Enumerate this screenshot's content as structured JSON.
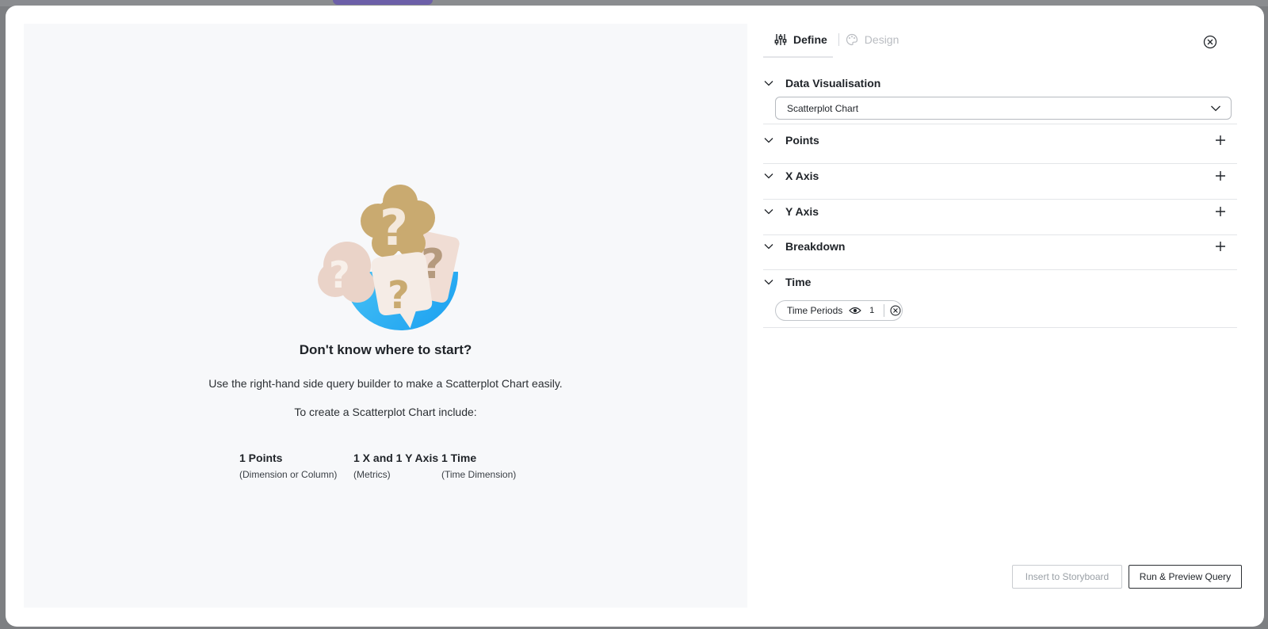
{
  "tabs": [
    {
      "label": "Define",
      "active": true,
      "icon": "sliders-icon"
    },
    {
      "label": "Design",
      "active": false,
      "icon": "palette-icon"
    }
  ],
  "empty_state": {
    "title": "Don't know where to start?",
    "description": "Use the right-hand side query builder to make a Scatterplot Chart easily.",
    "include_text": "To create a Scatterplot Chart include:",
    "requirements": [
      {
        "title": "1 Points",
        "subtitle": "(Dimension or Column)"
      },
      {
        "title": "1 X and 1 Y Axis",
        "subtitle": "(Metrics)"
      },
      {
        "title": "1 Time",
        "subtitle": "(Time Dimension)"
      }
    ]
  },
  "sections": {
    "data_visualisation": {
      "title": "Data Visualisation",
      "selected": "Scatterplot Chart"
    },
    "points": {
      "title": "Points"
    },
    "x_axis": {
      "title": "X Axis"
    },
    "y_axis": {
      "title": "Y Axis"
    },
    "breakdown": {
      "title": "Breakdown"
    },
    "time": {
      "title": "Time",
      "chip": {
        "label": "Time Periods",
        "count": "1"
      }
    }
  },
  "buttons": {
    "insert": "Insert to Storyboard",
    "run": "Run & Preview Query"
  },
  "colors": {
    "accent_blue": "#1fa9ee",
    "gold": "#c9aa70",
    "panel_bg": "#f7f8fa"
  }
}
